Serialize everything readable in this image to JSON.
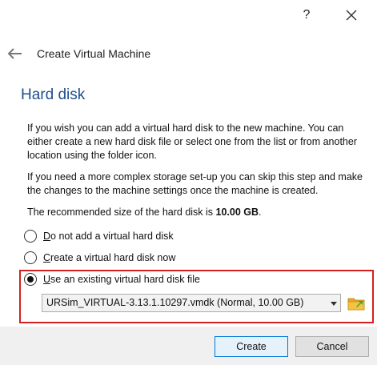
{
  "titlebar": {
    "help_label": "?",
    "close_icon": "close-icon"
  },
  "header": {
    "back_icon": "arrow-left-icon",
    "title": "Create Virtual Machine"
  },
  "page": {
    "title": "Hard disk",
    "desc1": "If you wish you can add a virtual hard disk to the new machine. You can either create a new hard disk file or select one from the list or from another location using the folder icon.",
    "desc2": "If you need a more complex storage set-up you can skip this step and make the changes to the machine settings once the machine is created.",
    "recommended_prefix": "The recommended size of the hard disk is ",
    "recommended_size": "10.00 GB",
    "recommended_suffix": "."
  },
  "options": [
    {
      "mnemonic": "D",
      "rest": "o not add a virtual hard disk",
      "checked": false
    },
    {
      "mnemonic": "C",
      "rest": "reate a virtual hard disk now",
      "checked": false
    },
    {
      "mnemonic": "U",
      "rest": "se an existing virtual hard disk file",
      "checked": true
    }
  ],
  "disk_select": {
    "selected": "URSim_VIRTUAL-3.13.1.10297.vmdk (Normal, 10.00 GB)"
  },
  "buttons": {
    "create": "Create",
    "cancel": "Cancel"
  },
  "colors": {
    "title_blue": "#1f4e8c",
    "highlight_red": "#d42020",
    "default_button_border": "#0078d7",
    "footer_bg": "#f0f0f0",
    "folder_yellow": "#f5c242",
    "folder_arrow_green": "#3aa83a"
  }
}
